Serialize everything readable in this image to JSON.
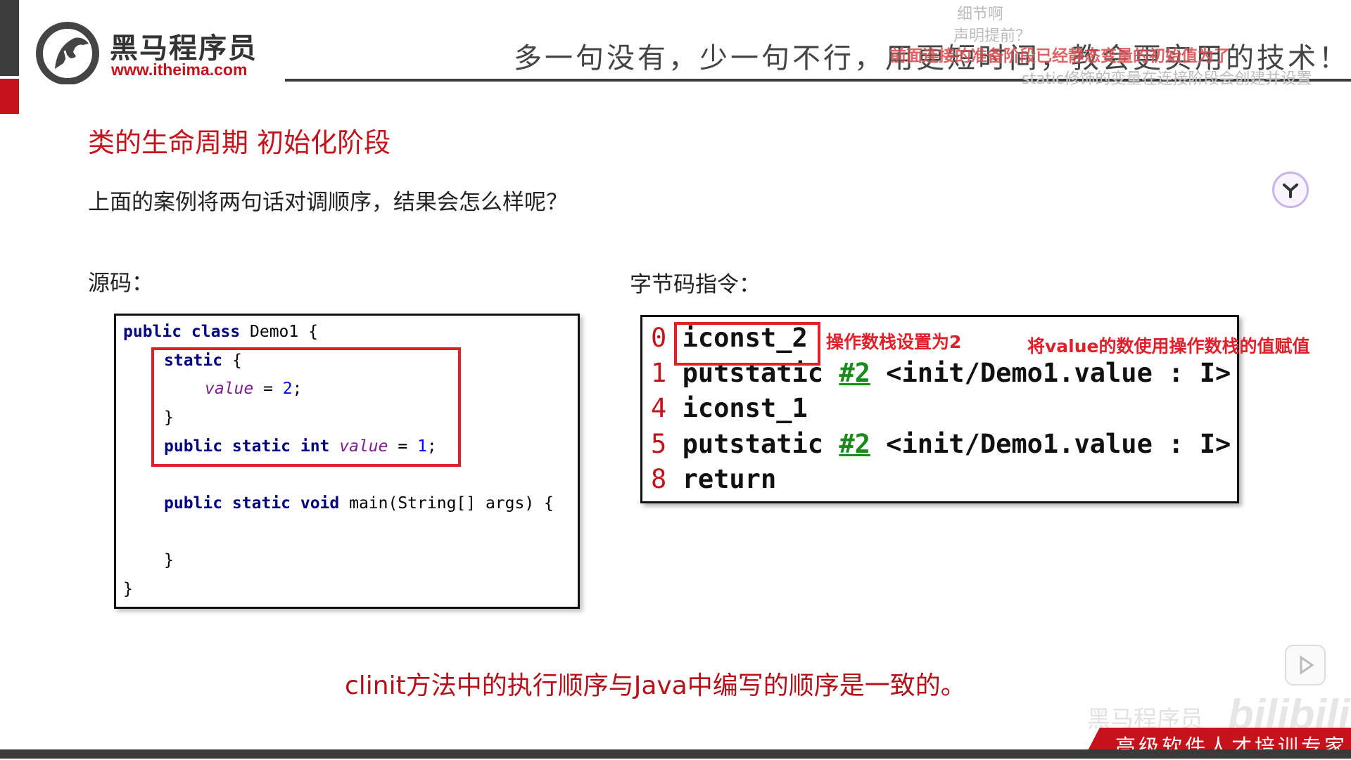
{
  "header": {
    "brand_name": "黑马程序员",
    "brand_url": "www.itheima.com",
    "slogan": "多一句没有，少一句不行，用更短时间，教会更实用的技术！"
  },
  "danmaku": [
    "细节啊",
    "声明提前？",
    "static修饰的变量在连接阶段会创建并设置",
    "前面连接的准备阶段已经静态变量的初始值为了"
  ],
  "slide": {
    "title": "类的生命周期 初始化阶段",
    "question": "上面的案例将两句话对调顺序，结果会怎么样呢？",
    "source_label": "源码：",
    "bytecode_label": "字节码指令：",
    "conclusion": "clinit方法中的执行顺序与Java中编写的顺序是一致的。"
  },
  "source_code": {
    "l1_kw": "public class",
    "l1_rest": " Demo1 {",
    "l2_kw": "static",
    "l2_rest": " {",
    "l3_field": "value",
    "l3_eq": " = ",
    "l3_num": "2",
    "l3_end": ";",
    "l4": "}",
    "l5_kw": "public static int",
    "l5_field": "value",
    "l5_eq": " = ",
    "l5_num": "1",
    "l5_end": ";",
    "l6_kw": "public static void",
    "l6_rest": " main(String[] args) {",
    "l7": "}",
    "l8": "}"
  },
  "bytecode": {
    "lines": [
      {
        "idx": "0",
        "op": "iconst_2",
        "ref": "",
        "rest": ""
      },
      {
        "idx": "1",
        "op": "putstatic",
        "ref": "#2",
        "rest": "<init/Demo1.value : I>"
      },
      {
        "idx": "4",
        "op": "iconst_1",
        "ref": "",
        "rest": ""
      },
      {
        "idx": "5",
        "op": "putstatic",
        "ref": "#2",
        "rest": "<init/Demo1.value : I>"
      },
      {
        "idx": "8",
        "op": "return",
        "ref": "",
        "rest": ""
      }
    ],
    "note_stack": "操作数栈设置为2",
    "note_assign": "将value的数使用操作数栈的值赋值"
  },
  "footer": {
    "tagline": "高级软件人才培训专家",
    "watermark_cn": "黑马程序员",
    "watermark_site": "bilibili"
  },
  "colors": {
    "brand_red": "#c6121b",
    "annotation_red": "#e0202a",
    "keyword_blue": "#000080",
    "ref_green": "#1a8a1a"
  }
}
